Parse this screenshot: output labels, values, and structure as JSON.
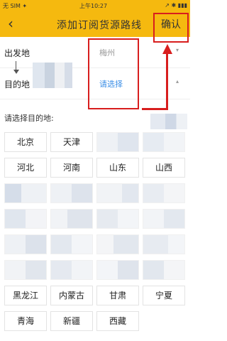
{
  "status_bar": {
    "carrier": "无 SIM ✦",
    "time": "上午10:27",
    "indicators": "↗ ✱ ▮▮▮"
  },
  "header": {
    "back_icon": "chevron-left-icon",
    "back_glyph": "‹",
    "title": "添加订阅货源路线",
    "confirm_label": "确认"
  },
  "form": {
    "origin": {
      "label": "出发地",
      "value": "梅州",
      "arrow_glyph": "▾"
    },
    "destination": {
      "label": "目的地",
      "value": "请选择",
      "arrow_glyph": "▴"
    }
  },
  "prompt": "请选择目的地:",
  "regions": {
    "row1": [
      "北京",
      "天津",
      "",
      ""
    ],
    "row2": [
      "河北",
      "河南",
      "山东",
      "山西"
    ],
    "row8": [
      "黑龙江",
      "内蒙古",
      "甘肃",
      "宁夏"
    ],
    "row9": [
      "青海",
      "新疆",
      "西藏"
    ]
  },
  "colors": {
    "header_bg": "#f5b90f",
    "annotation_red": "#d81e1e",
    "link_blue": "#3a8ee6"
  }
}
